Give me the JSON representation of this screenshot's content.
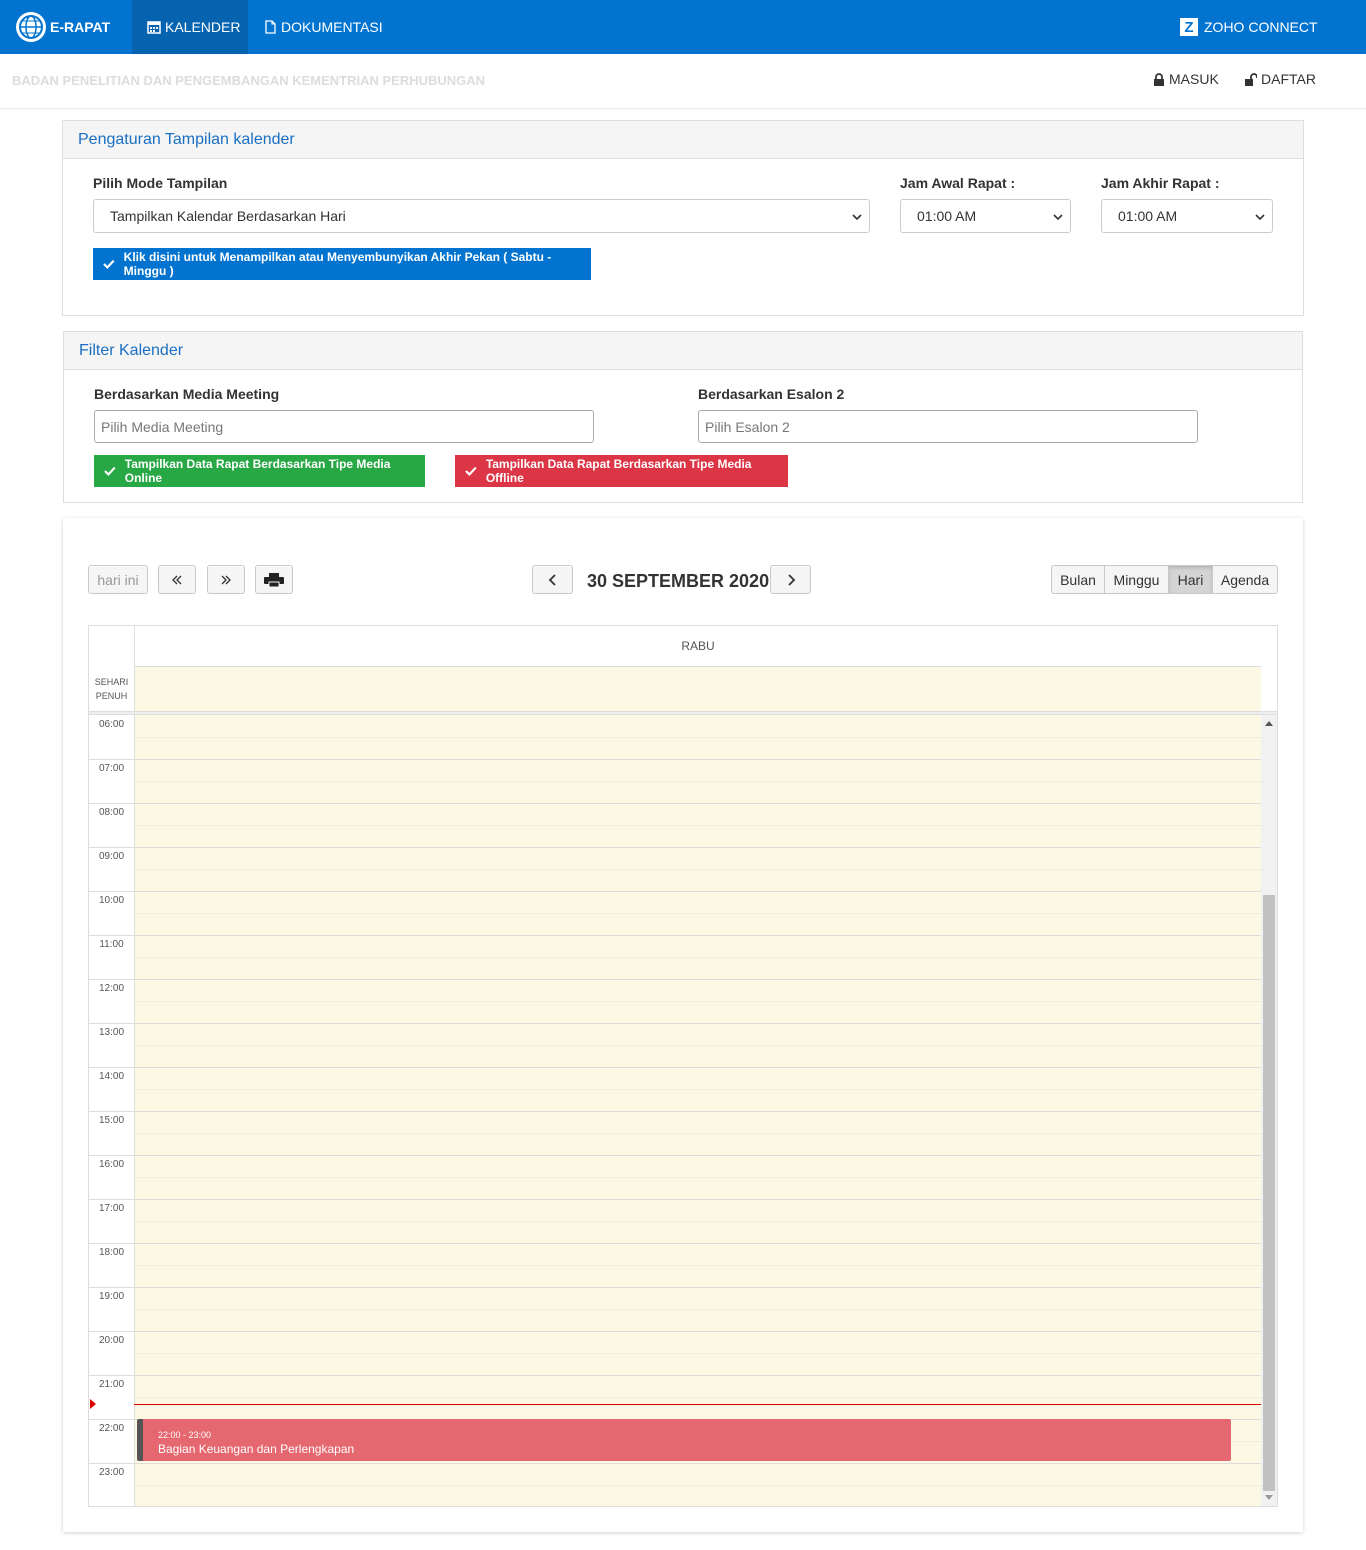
{
  "navbar": {
    "brand": "E-RAPAT",
    "items": [
      {
        "label": "KALENDER",
        "icon": "calendar-icon",
        "active": true
      },
      {
        "label": "DOKUMENTASI",
        "icon": "file-icon",
        "active": false
      }
    ],
    "zoho": {
      "icon_letter": "Z",
      "label": "ZOHO CONNECT"
    }
  },
  "subheader": {
    "org": "BADAN PENELITIAN DAN PENGEMBANGAN KEMENTRIAN PERHUBUNGAN",
    "login": "MASUK",
    "register": "DAFTAR"
  },
  "settings": {
    "title": "Pengaturan Tampilan kalender",
    "mode_label": "Pilih Mode Tampilan",
    "mode_value": "Tampilkan Kalendar Berdasarkan Hari",
    "start_label": "Jam Awal Rapat :",
    "start_value": "01:00 AM",
    "end_label": "Jam Akhir Rapat :",
    "end_value": "01:00 AM",
    "weekend_button": "Klik disini untuk Menampilkan atau Menyembunyikan Akhir Pekan ( Sabtu - Minggu )"
  },
  "filter": {
    "title": "Filter Kalender",
    "media_label": "Berdasarkan Media Meeting",
    "media_placeholder": "Pilih Media Meeting",
    "esalon_label": "Berdasarkan Esalon 2",
    "esalon_placeholder": "Pilih Esalon 2",
    "online_button": "Tampilkan Data Rapat Berdasarkan Tipe Media Online",
    "offline_button": "Tampilkan Data Rapat Berdasarkan Tipe Media Offline"
  },
  "calendar": {
    "today_button": "hari ini",
    "title": "30 SEPTEMBER 2020",
    "views": [
      "Bulan",
      "Minggu",
      "Hari",
      "Agenda"
    ],
    "active_view": "Hari",
    "day_header": "RABU",
    "allday_label_1": "SEHARI",
    "allday_label_2": "PENUH",
    "times": [
      "06:00",
      "07:00",
      "08:00",
      "09:00",
      "10:00",
      "11:00",
      "12:00",
      "13:00",
      "14:00",
      "15:00",
      "16:00",
      "17:00",
      "18:00",
      "19:00",
      "20:00",
      "21:00",
      "22:00",
      "23:00"
    ],
    "event": {
      "time": "22:00 - 23:00",
      "title": "Bagian Keuangan dan Perlengkapan",
      "color": "#e5676f"
    }
  },
  "colors": {
    "primary": "#0274d0",
    "success": "#28a745",
    "danger": "#dc3545",
    "highlight": "#fcf8e3"
  }
}
